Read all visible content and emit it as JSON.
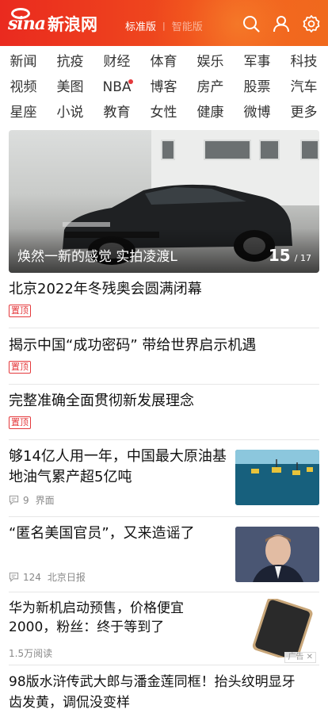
{
  "header": {
    "brand_latin": "sina",
    "brand_cn": "新浪网",
    "edition_active": "标准版",
    "edition_separator": "|",
    "edition_inactive": "智能版",
    "icons": [
      "search-icon",
      "user-icon",
      "settings-icon"
    ],
    "brand_color": "#ea2a1f"
  },
  "nav": {
    "items": [
      "新闻",
      "抗疫",
      "财经",
      "体育",
      "娱乐",
      "军事",
      "科技",
      "视频",
      "美图",
      "NBA",
      "博客",
      "房产",
      "股票",
      "汽车",
      "星座",
      "小说",
      "教育",
      "女性",
      "健康",
      "微博",
      "更多"
    ],
    "dot_item": "NBA"
  },
  "hero": {
    "caption": "焕然一新的感觉 实拍凌渡L",
    "current": "15",
    "total": "/ 17"
  },
  "feed": {
    "pinned": [
      {
        "title": "北京2022年冬残奥会圆满闭幕",
        "badge": "置顶"
      },
      {
        "title": "揭示中国“成功密码” 带给世界启示机遇",
        "badge": "置顶"
      },
      {
        "title": "完整准确全面贯彻新发展理念",
        "badge": "置顶"
      }
    ],
    "articles": [
      {
        "title_line1": "够14亿人用一年，中国最大原油基",
        "title_line2": "地油气累产超5亿吨",
        "comments": "9",
        "source": "界面"
      },
      {
        "title": "“匿名美国官员”，又来造谣了",
        "comments": "124",
        "source": "北京日报"
      }
    ],
    "ad": {
      "title_line1": "华为新机启动预售，价格便宜",
      "title_line2": "2000，粉丝：终于等到了",
      "reads": "1.5万阅读",
      "tag": "广告 ✕"
    },
    "last": {
      "title_line1": "98版水浒传武大郎与潘金莲同框！抬头纹明显牙",
      "title_line2": "齿发黄，调侃没变样"
    }
  }
}
